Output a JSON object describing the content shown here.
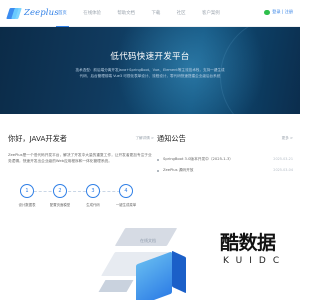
{
  "header": {
    "logo_text": "Zeeplus",
    "nav": [
      {
        "label": "首页",
        "active": true
      },
      {
        "label": "在线体验"
      },
      {
        "label": "帮助文档"
      },
      {
        "label": "下载"
      },
      {
        "label": "社区"
      },
      {
        "label": "客户案例"
      }
    ],
    "login_label": "登录 | 注册"
  },
  "hero": {
    "title": "低代码快速开发平台",
    "desc_lines": [
      "技术选型：前后端分离开发Java+SpringBoot、Vue、Element等主流技术栈，支持一键生成",
      "代码，后台管理前端 Vue3 可视化表单设计、流程设计，零代码快速搭建企业级后台系统"
    ]
  },
  "left": {
    "title": "你好，JAVA开发者",
    "more_label": "了解详情 >",
    "intro": "ZeePlus是一个低代码开发平台，解决了开发中大量的重复工作，让开发者更加专注于业务逻辑，快速开发出企业级的Web应用程序和一体化管理系统。",
    "steps": [
      {
        "num": "1",
        "label": "设计数据表"
      },
      {
        "num": "2",
        "label": "配置页面模型"
      },
      {
        "num": "3",
        "label": "生成代码"
      },
      {
        "num": "4",
        "label": "一键生成菜单"
      }
    ]
  },
  "notice": {
    "title": "通知公告",
    "more_label": "更多 >",
    "items": [
      {
        "title": "SpringBoot 3.0版本开发中（2025-1-3）",
        "date": "2025-03-21"
      },
      {
        "title": "ZeePlus 源码开放",
        "date": "2025-03-04"
      }
    ]
  },
  "illustration": {
    "label": "在线文档"
  },
  "watermark": {
    "main": "酷数据",
    "sub": "KUIDC"
  },
  "colors": {
    "accent": "#2f7fe6",
    "hero_bg": "#0f3a5f",
    "wechat": "#2fbf4c"
  }
}
